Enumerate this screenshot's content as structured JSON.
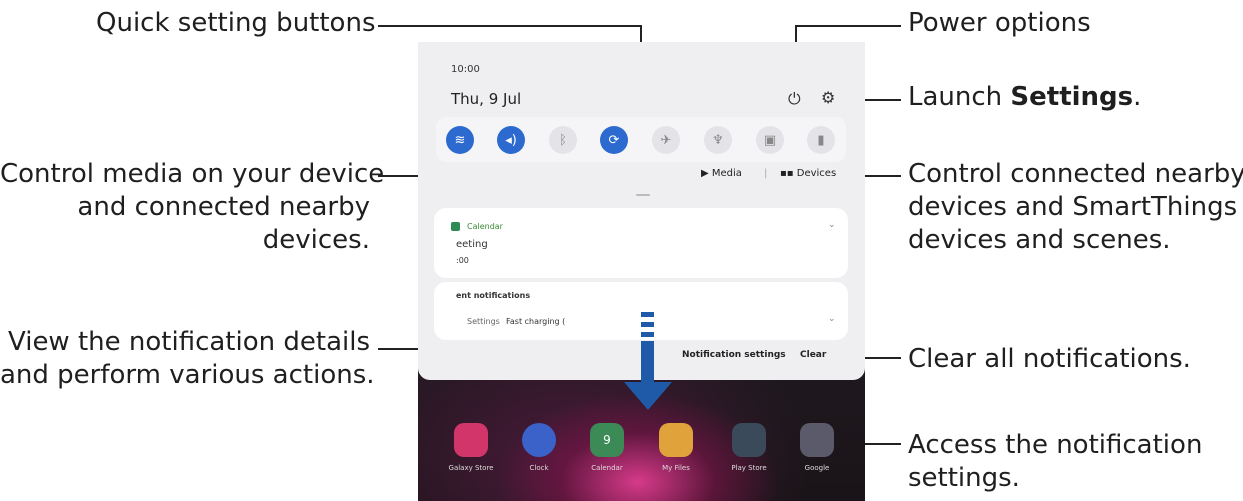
{
  "annotations": {
    "quick_settings": "Quick setting buttons",
    "power_options": "Power options",
    "launch_settings_prefix": "Launch ",
    "launch_settings_bold": "Settings",
    "launch_settings_suffix": ".",
    "media_line1": "Control media on your device",
    "media_line2": "and connected nearby",
    "media_line3": "devices.",
    "devices_line1": "Control connected nearby",
    "devices_line2": "devices and SmartThings",
    "devices_line3": "devices and scenes.",
    "details_line1": "View the notification details",
    "details_line2": "and perform various actions.",
    "clear_text": "Clear all notifications.",
    "notif_settings_line1": "Access the notification",
    "notif_settings_line2": "settings."
  },
  "phone": {
    "status_time": "10:00",
    "date": "Thu, 9 Jul",
    "quick_tiles": [
      {
        "name": "wifi",
        "state": "on",
        "glyph": "≋"
      },
      {
        "name": "sound",
        "state": "on",
        "glyph": "◂)"
      },
      {
        "name": "bluetooth",
        "state": "off",
        "glyph": "ᛒ"
      },
      {
        "name": "auto-rotate",
        "state": "on",
        "glyph": "⟳"
      },
      {
        "name": "airplane",
        "state": "off",
        "glyph": "✈"
      },
      {
        "name": "flashlight",
        "state": "off",
        "glyph": "♆"
      },
      {
        "name": "battery-saver",
        "state": "off",
        "glyph": "▣"
      },
      {
        "name": "power-share",
        "state": "off",
        "glyph": "▮"
      }
    ],
    "media_label": "Media",
    "devices_label": "Devices",
    "calendar_app": "Calendar",
    "calendar_title": "eeting",
    "calendar_time": ":00",
    "recent_header": "ent notifications",
    "recent_item_app": "Settings",
    "recent_item_text": "Fast charging (",
    "notification_settings_btn": "Notification settings",
    "clear_btn": "Clear",
    "apps": [
      "Galaxy Store",
      "Clock",
      "Calendar",
      "My Files",
      "Play Store",
      "Google"
    ],
    "calendar_app_number": "9"
  },
  "colors": {
    "accent": "#2d6ad0",
    "arrow": "#1e5aa8",
    "panel": "#efeff2"
  }
}
